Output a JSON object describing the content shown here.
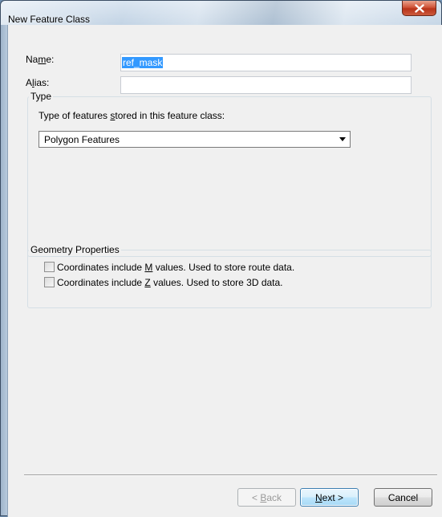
{
  "window": {
    "title": "New Feature Class"
  },
  "form": {
    "name_label_pre": "Na",
    "name_label_mnemonic": "m",
    "name_label_post": "e:",
    "name_value": "ref_mask",
    "alias_label_pre": "A",
    "alias_label_mnemonic": "l",
    "alias_label_post": "ias:",
    "alias_value": ""
  },
  "type_group": {
    "legend": "Type",
    "prompt_pre": "Type of features ",
    "prompt_mnemonic": "s",
    "prompt_post": "tored in this feature class:",
    "selected": "Polygon Features"
  },
  "geometry_group": {
    "legend": "Geometry Properties",
    "m_values_pre": "Coordinates include ",
    "m_values_mnemonic": "M",
    "m_values_post": " values. Used to store route data.",
    "m_values_checked": false,
    "z_values_pre": "Coordinates include ",
    "z_values_mnemonic": "Z",
    "z_values_post": " values. Used to store 3D data.",
    "z_values_checked": false
  },
  "buttons": {
    "back_pre": "< ",
    "back_mnemonic": "B",
    "back_post": "ack",
    "next_mnemonic": "N",
    "next_post": "ext >",
    "cancel": "Cancel"
  },
  "icons": {
    "close": "close-icon",
    "dropdown": "chevron-down-icon"
  },
  "colors": {
    "selection": "#3399ff",
    "close_button": "#c8442a",
    "default_button_border": "#3c7fb1"
  }
}
